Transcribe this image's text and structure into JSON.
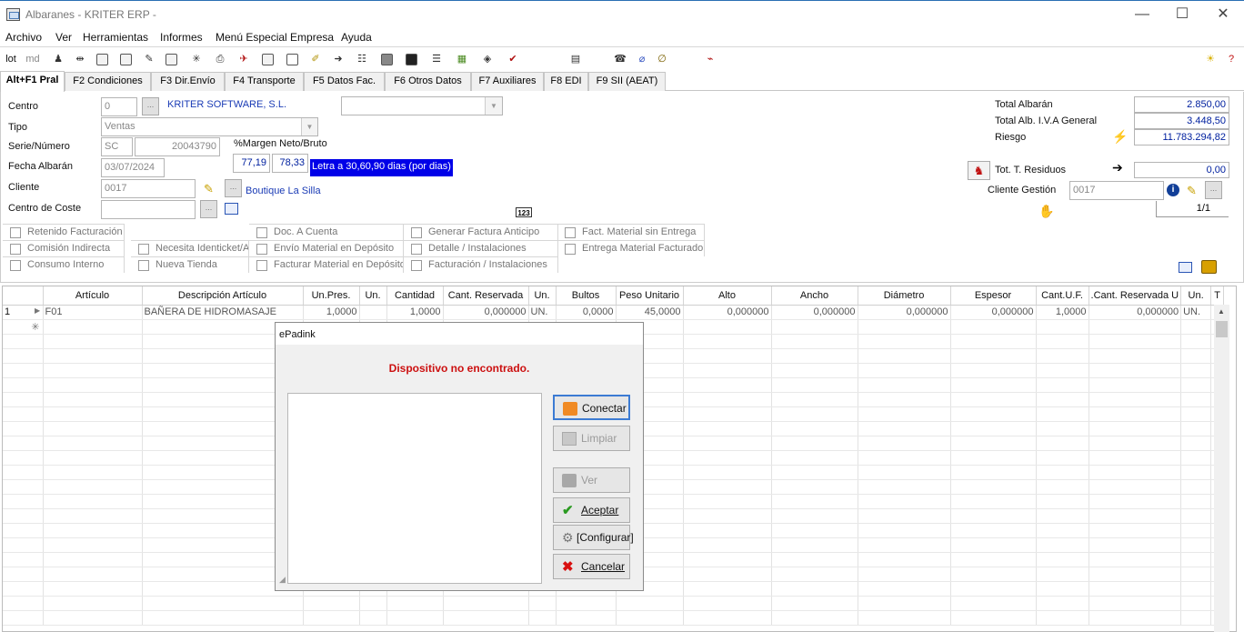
{
  "window": {
    "title": "Albaranes - KRITER ERP -",
    "minimize": "—",
    "maximize": "☐",
    "close": "✕"
  },
  "menu": [
    "Archivo",
    "Ver",
    "Herramientas",
    "Informes",
    "Menú Especial Empresa",
    "Ayuda"
  ],
  "toolbar": {
    "lot": "lot",
    "md": "md"
  },
  "tabs": [
    "Alt+F1 Pral",
    "F2 Condiciones",
    "F3 Dir.Envío",
    "F4 Transporte",
    "F5 Datos Fac.",
    "F6 Otros Datos",
    "F7 Auxiliares",
    "F8 EDI",
    "F9 SII (AEAT)"
  ],
  "form": {
    "centro_label": "Centro",
    "centro_code": "0",
    "centro_name": "KRITER SOFTWARE, S.L.",
    "tipo_label": "Tipo",
    "tipo_value": "Ventas",
    "serie_label": "Serie/Número",
    "serie": "SC",
    "numero": "20043790",
    "margen_label": "%Margen Neto/Bruto",
    "margen_neto": "77,19",
    "margen_bruto": "78,33",
    "forma_pago": "Letra a 30,60,90 dias (por dias)",
    "fecha_label": "Fecha Albarán",
    "fecha": "03/07/2024",
    "cliente_label": "Cliente",
    "cliente_code": "0017",
    "cliente_name": "Boutique La Silla",
    "coste_label": "Centro de Coste",
    "badge_123": "123",
    "ellipsis": "...",
    "total_albaran_label": "Total Albarán",
    "total_albaran": "2.850,00",
    "total_iva_label": "Total Alb. I.V.A General",
    "total_iva": "3.448,50",
    "riesgo_label": "Riesgo",
    "riesgo": "11.783.294,82",
    "residuos_label": "Tot. T. Residuos",
    "residuos": "0,00",
    "cliente_gestion_label": "Cliente Gestión",
    "cliente_gestion": "0017",
    "pager": "1/1"
  },
  "checkboxes": [
    "Retenido Facturación",
    "Comisión Indirecta",
    "Consumo Interno",
    "Necesita Identicket/A",
    "Nueva Tienda",
    "Doc. A Cuenta",
    "Envío Material en Depósito",
    "Facturar Material en Depósito",
    "Generar Factura Anticipo",
    "Detalle / Instalaciones",
    "Facturación / Instalaciones",
    "Fact. Material sin Entrega",
    "Entrega Material Facturado"
  ],
  "grid": {
    "columns": [
      "",
      "Artículo",
      "Descripción Artículo",
      "Un.Pres.",
      "Un.",
      "Cantidad",
      "Cant. Reservada",
      "Un.",
      "Bultos",
      "Peso Unitario",
      "Alto",
      "Ancho",
      "Diámetro",
      "Espesor",
      "Cant.U.F.",
      "Cant. Reservada U.",
      "Un.",
      "T"
    ],
    "rows": [
      [
        "1",
        "F01",
        "BAÑERA DE HIDROMASAJE",
        "1,0000",
        "",
        "1,0000",
        "0,000000",
        "UN.",
        "0,0000",
        "45,0000",
        "0,000000",
        "0,000000",
        "0,000000",
        "0,000000",
        "1,0000",
        "0,000000",
        "UN.",
        ""
      ]
    ],
    "new_row_marker": "✳"
  },
  "dialog": {
    "title": "ePadink",
    "message": "Dispositivo no encontrado.",
    "buttons": [
      "Conectar",
      "Limpiar",
      "Ver",
      "Aceptar",
      "[Configurar]",
      "Cancelar"
    ]
  }
}
